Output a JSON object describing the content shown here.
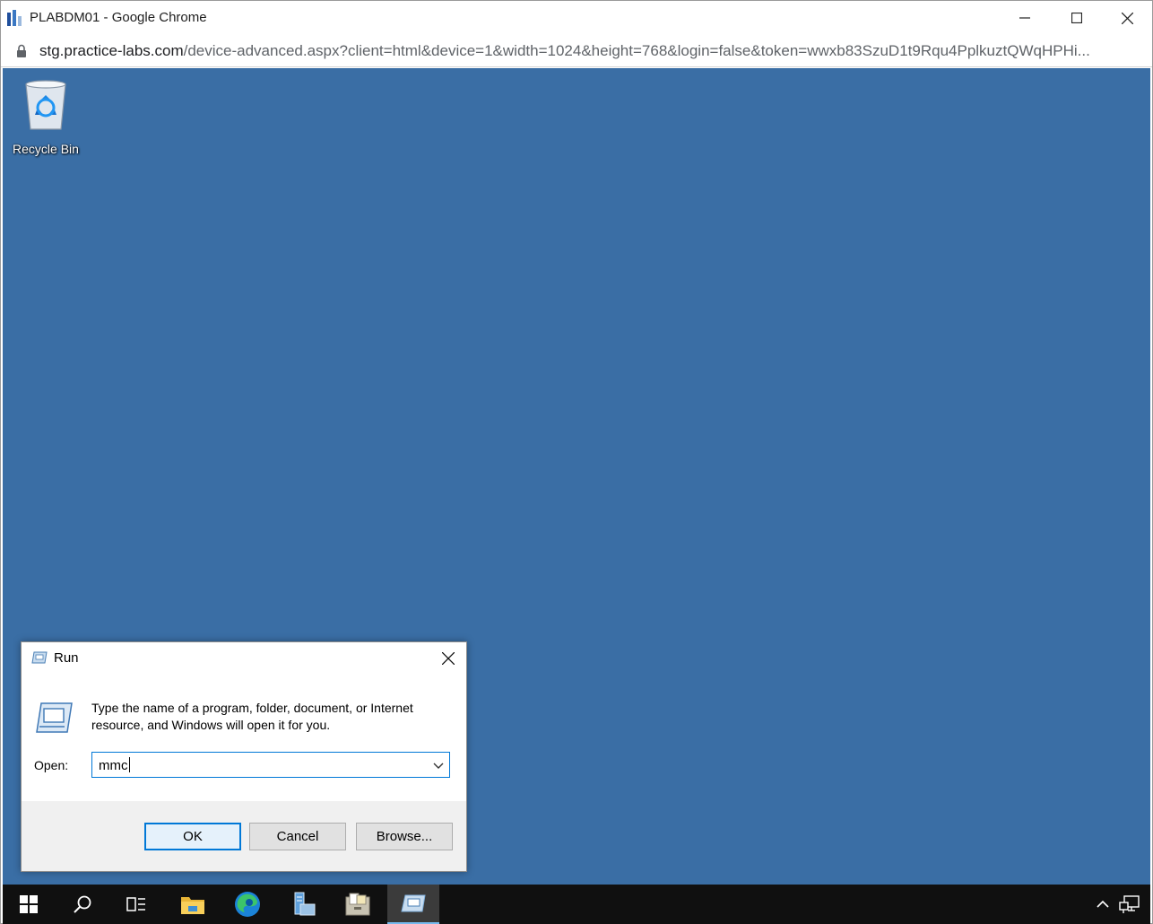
{
  "browser": {
    "title": "PLABDM01 - Google Chrome",
    "url_host": "stg.practice-labs.com",
    "url_path": "/device-advanced.aspx?client=html&device=1&width=1024&height=768&login=false&token=wwxb83SzuD1t9Rqu4PplkuztQWqHPHi..."
  },
  "desktop": {
    "background": "#3a6ea5",
    "icons": [
      {
        "label": "Recycle Bin",
        "icon": "recycle-bin-icon"
      }
    ]
  },
  "run_dialog": {
    "title": "Run",
    "description": "Type the name of a program, folder, document, or Internet resource, and Windows will open it for you.",
    "open_label": "Open:",
    "open_value": "mmc",
    "buttons": {
      "ok": "OK",
      "cancel": "Cancel",
      "browse": "Browse..."
    }
  },
  "taskbar": {
    "items": [
      {
        "name": "start",
        "icon": "windows-logo-icon"
      },
      {
        "name": "search",
        "icon": "search-icon"
      },
      {
        "name": "task-view",
        "icon": "task-view-icon"
      },
      {
        "name": "file-explorer",
        "icon": "folder-icon"
      },
      {
        "name": "edge",
        "icon": "edge-icon"
      },
      {
        "name": "server-manager",
        "icon": "server-manager-icon"
      },
      {
        "name": "file-cabinet",
        "icon": "file-cabinet-icon"
      },
      {
        "name": "run",
        "icon": "run-icon",
        "active": true
      }
    ],
    "tray": [
      "chevron-up-icon",
      "network-icon"
    ]
  }
}
